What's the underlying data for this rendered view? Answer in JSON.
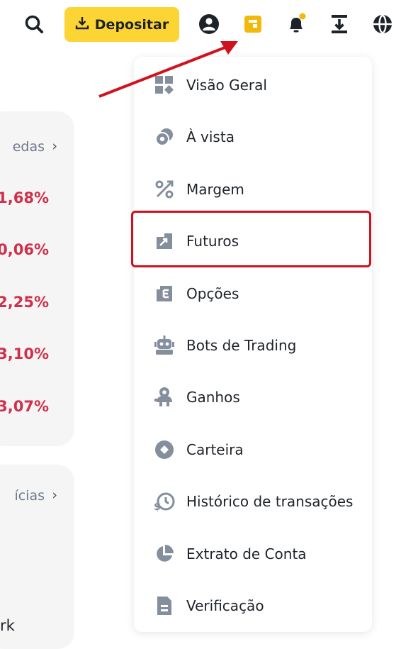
{
  "header": {
    "deposit_label": "Depositar",
    "icons": [
      "search-icon",
      "download-icon",
      "user-icon",
      "wallet-icon",
      "bell-icon",
      "transfer-icon",
      "globe-icon"
    ]
  },
  "markets_card": {
    "heading": "edas",
    "values": [
      "1,68%",
      "0,06%",
      "2,25%",
      "3,10%",
      "3,07%"
    ]
  },
  "news_card": {
    "heading": "ícias",
    "bottom_text": "rk"
  },
  "wallet_menu": {
    "items": [
      {
        "label": "Visão Geral",
        "icon": "overview-icon"
      },
      {
        "label": "À vista",
        "icon": "spot-icon"
      },
      {
        "label": "Margem",
        "icon": "margin-icon"
      },
      {
        "label": "Futuros",
        "icon": "futures-icon"
      },
      {
        "label": "Opções",
        "icon": "options-icon"
      },
      {
        "label": "Bots de Trading",
        "icon": "robot-icon"
      },
      {
        "label": "Ganhos",
        "icon": "earn-icon"
      },
      {
        "label": "Carteira",
        "icon": "wallet-coin-icon"
      },
      {
        "label": "Histórico de transações",
        "icon": "history-icon"
      },
      {
        "label": "Extrato de Conta",
        "icon": "pie-chart-icon"
      },
      {
        "label": "Verificação",
        "icon": "document-icon"
      }
    ]
  },
  "colors": {
    "accent": "#fcd535",
    "negative": "#cf304a",
    "highlight": "#d0121f",
    "icon_gray": "#848e9c"
  }
}
